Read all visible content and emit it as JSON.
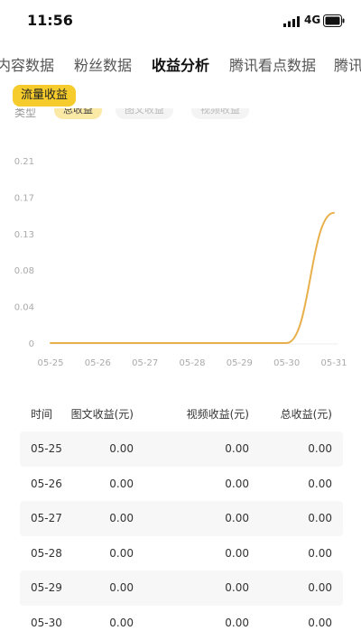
{
  "status_bar": {
    "time": "11:56",
    "network": "4G"
  },
  "tabs": [
    {
      "label": "内容数据",
      "active": false
    },
    {
      "label": "粉丝数据",
      "active": false
    },
    {
      "label": "收益分析",
      "active": true
    },
    {
      "label": "腾讯看点数据",
      "active": false
    },
    {
      "label": "腾讯",
      "active": false
    }
  ],
  "section_badge": "流量收益",
  "filter": {
    "label": "类型",
    "chips": [
      {
        "label": "总收益",
        "selected": true
      },
      {
        "label": "图文收益",
        "selected": false
      },
      {
        "label": "视频收益",
        "selected": false
      }
    ]
  },
  "chart_data": {
    "type": "line",
    "x": [
      "05-25",
      "05-26",
      "05-27",
      "05-28",
      "05-29",
      "05-30",
      "05-31"
    ],
    "series": [
      {
        "values": [
          0,
          0,
          0,
          0,
          0,
          0,
          0.15
        ],
        "color": "#e8b04a"
      }
    ],
    "y_ticks": [
      "0.21",
      "0.17",
      "0.13",
      "0.08",
      "0.04",
      "0"
    ],
    "ylim": [
      0,
      0.21
    ],
    "grid": false,
    "axis_color": "#eeeeee"
  },
  "table": {
    "headers": [
      "时间",
      "图文收益(元)",
      "视频收益(元)",
      "总收益(元)"
    ],
    "rows": [
      [
        "05-25",
        "0.00",
        "0.00",
        "0.00"
      ],
      [
        "05-26",
        "0.00",
        "0.00",
        "0.00"
      ],
      [
        "05-27",
        "0.00",
        "0.00",
        "0.00"
      ],
      [
        "05-28",
        "0.00",
        "0.00",
        "0.00"
      ],
      [
        "05-29",
        "0.00",
        "0.00",
        "0.00"
      ],
      [
        "05-30",
        "0.00",
        "0.00",
        "0.00"
      ]
    ]
  }
}
